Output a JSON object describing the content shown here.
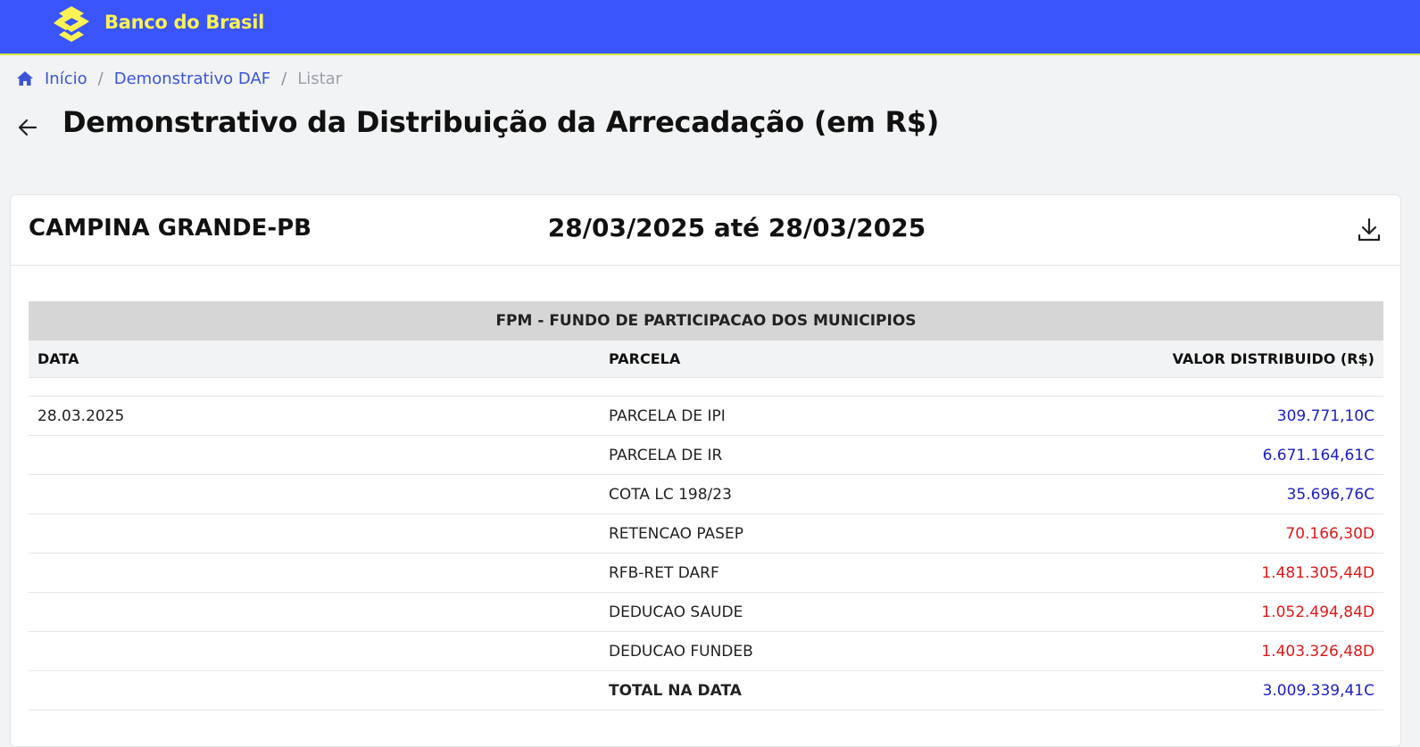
{
  "brand": {
    "name": "Banco do Brasil"
  },
  "breadcrumb": {
    "home": "Início",
    "section": "Demonstrativo DAF",
    "current": "Listar",
    "separator": "/"
  },
  "page": {
    "title": "Demonstrativo da Distribuição da Arrecadação (em R$)"
  },
  "report": {
    "municipio": "CAMPINA GRANDE-PB",
    "periodo": "28/03/2025 até 28/03/2025",
    "section_title": "FPM - FUNDO DE PARTICIPACAO DOS MUNICIPIOS",
    "columns": {
      "data": "DATA",
      "parcela": "PARCELA",
      "valor": "VALOR DISTRIBUIDO (R$)"
    },
    "rows": [
      {
        "data": "28.03.2025",
        "parcela": "PARCELA DE IPI",
        "valor": "309.771,10C"
      },
      {
        "data": "",
        "parcela": "PARCELA DE IR",
        "valor": "6.671.164,61C"
      },
      {
        "data": "",
        "parcela": "COTA LC 198/23",
        "valor": "35.696,76C"
      },
      {
        "data": "",
        "parcela": "RETENCAO PASEP",
        "valor": "70.166,30D"
      },
      {
        "data": "",
        "parcela": "RFB-RET DARF",
        "valor": "1.481.305,44D"
      },
      {
        "data": "",
        "parcela": "DEDUCAO SAUDE",
        "valor": "1.052.494,84D"
      },
      {
        "data": "",
        "parcela": "DEDUCAO FUNDEB",
        "valor": "1.403.326,48D"
      },
      {
        "data": "",
        "parcela": "TOTAL NA DATA",
        "valor": "3.009.339,41C"
      }
    ]
  },
  "colors": {
    "topbar": "#3a55fc",
    "brand_yellow": "#fcf353",
    "credit": "#1a1fc4",
    "debit": "#e01818",
    "link": "#3a55d8"
  },
  "icons": {
    "logo": "bb-logo-icon",
    "home": "home-icon",
    "back": "arrow-left-icon",
    "download": "download-icon"
  }
}
